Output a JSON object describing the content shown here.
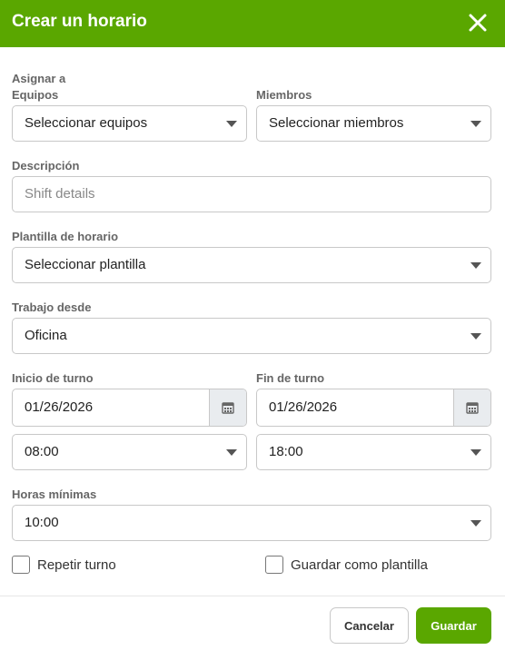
{
  "dialog": {
    "title": "Crear un horario",
    "accent_color": "#5aa700"
  },
  "form": {
    "assign_label": "Asignar a",
    "teams": {
      "label": "Equipos",
      "value": "Seleccionar equipos"
    },
    "members": {
      "label": "Miembros",
      "value": "Seleccionar miembros"
    },
    "description": {
      "label": "Descripción",
      "placeholder": "Shift details",
      "value": ""
    },
    "template": {
      "label": "Plantilla de horario",
      "value": "Seleccionar plantilla"
    },
    "work_from": {
      "label": "Trabajo desde",
      "value": "Oficina"
    },
    "shift_start": {
      "label": "Inicio de turno",
      "date": "01/26/2026",
      "time": "08:00"
    },
    "shift_end": {
      "label": "Fin de turno",
      "date": "01/26/2026",
      "time": "18:00"
    },
    "min_hours": {
      "label": "Horas mínimas",
      "value": "10:00"
    },
    "repeat_shift": {
      "label": "Repetir turno",
      "checked": false
    },
    "save_template": {
      "label": "Guardar como plantilla",
      "checked": false
    }
  },
  "footer": {
    "cancel_label": "Cancelar",
    "save_label": "Guardar"
  },
  "icons": {
    "close": "close-icon",
    "calendar": "calendar-icon",
    "dropdown": "chevron-down-icon"
  }
}
